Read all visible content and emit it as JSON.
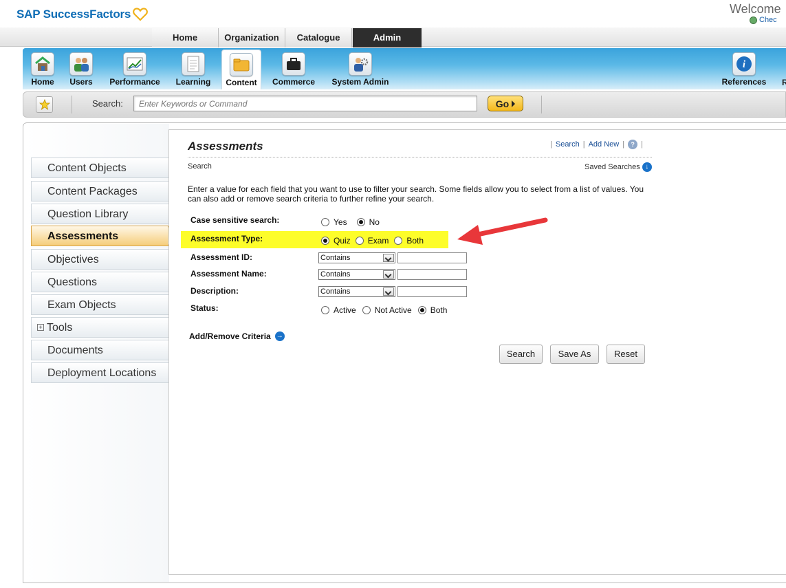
{
  "header": {
    "brand": "SAP SuccessFactors",
    "welcome": "Welcome",
    "check_link": "Chec"
  },
  "top_tabs": [
    {
      "label": "Home",
      "active": false
    },
    {
      "label": "Organization",
      "active": false
    },
    {
      "label": "Catalogue",
      "active": false
    },
    {
      "label": "Admin",
      "active": true
    }
  ],
  "nav": [
    {
      "label": "Home",
      "icon": "home-icon"
    },
    {
      "label": "Users",
      "icon": "users-icon"
    },
    {
      "label": "Performance",
      "icon": "performance-chart-icon"
    },
    {
      "label": "Learning",
      "icon": "learning-document-icon"
    },
    {
      "label": "Content",
      "icon": "content-folder-icon",
      "active": true
    },
    {
      "label": "Commerce",
      "icon": "briefcase-icon"
    },
    {
      "label": "System Admin",
      "icon": "system-admin-icon"
    },
    {
      "label": "References",
      "icon": "info-icon"
    }
  ],
  "searchbar": {
    "label": "Search:",
    "placeholder": "Enter Keywords or Command",
    "go": "Go"
  },
  "sidebar": {
    "items": [
      {
        "label": "Content Objects"
      },
      {
        "label": "Content Packages"
      },
      {
        "label": "Question Library"
      },
      {
        "label": "Assessments",
        "active": true
      },
      {
        "label": "Objectives"
      },
      {
        "label": "Questions"
      },
      {
        "label": "Exam Objects"
      },
      {
        "label": "Tools",
        "expandable": true
      },
      {
        "label": "Documents"
      },
      {
        "label": "Deployment Locations"
      }
    ]
  },
  "main": {
    "title": "Assessments",
    "links": {
      "search": "Search",
      "add_new": "Add New",
      "help": "?"
    },
    "subheader": "Search",
    "saved_searches": "Saved Searches",
    "description": "Enter a value for each field that you want to use to filter your search. Some fields allow you to select from a list of values. You can also add or remove search criteria to further refine your search.",
    "fields": {
      "case_sensitive": {
        "label": "Case sensitive search:",
        "options": [
          "Yes",
          "No"
        ],
        "selected": "No"
      },
      "assessment_type": {
        "label": "Assessment Type:",
        "options": [
          "Quiz",
          "Exam",
          "Both"
        ],
        "selected": "Quiz",
        "highlight_color": "#fdfd2a"
      },
      "assessment_id": {
        "label": "Assessment ID:",
        "operator": "Contains",
        "value": ""
      },
      "assessment_name": {
        "label": "Assessment Name:",
        "operator": "Contains",
        "value": ""
      },
      "description": {
        "label": "Description:",
        "operator": "Contains",
        "value": ""
      },
      "status": {
        "label": "Status:",
        "options": [
          "Active",
          "Not Active",
          "Both"
        ],
        "selected": "Both"
      }
    },
    "add_remove": "Add/Remove Criteria",
    "buttons": {
      "search": "Search",
      "save_as": "Save As",
      "reset": "Reset"
    }
  },
  "annotation": {
    "arrow_color": "#e8373a"
  }
}
